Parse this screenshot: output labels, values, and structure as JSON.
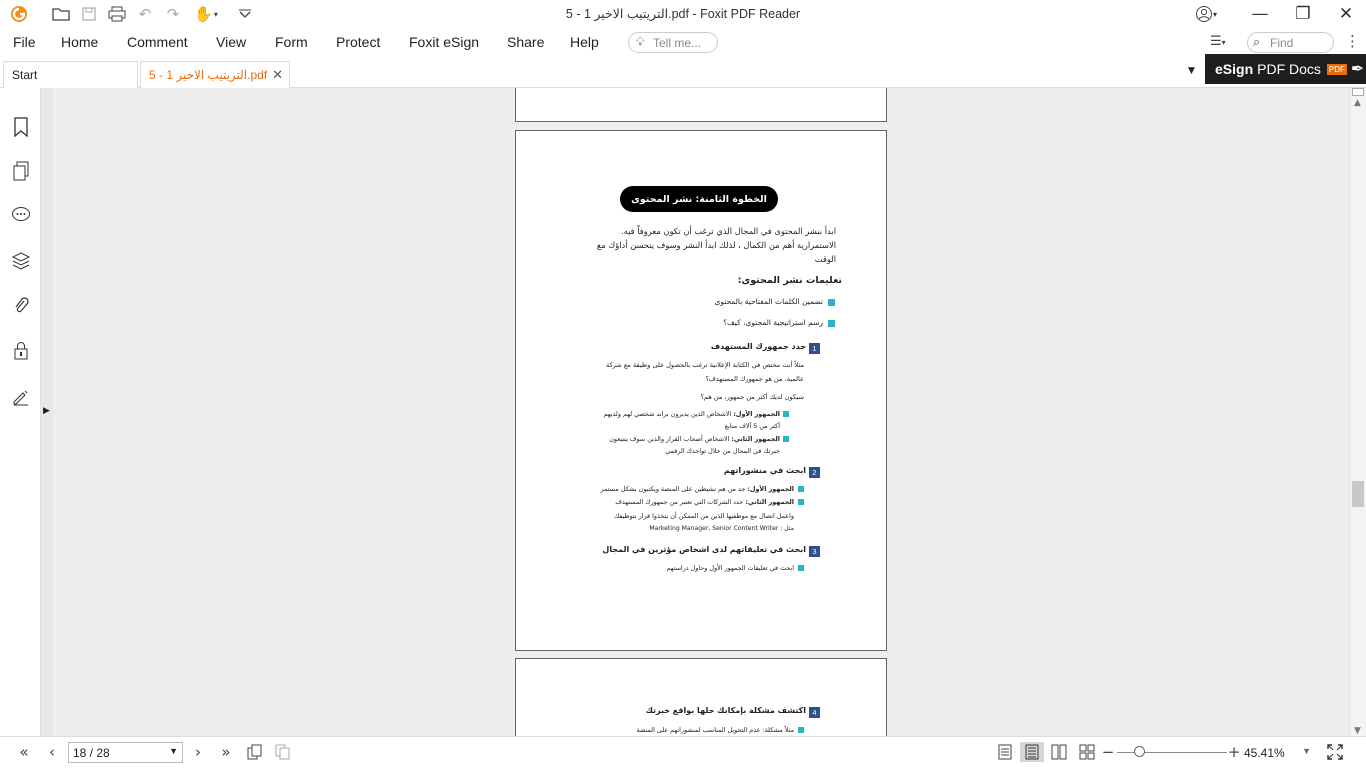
{
  "window": {
    "title": "5 - التريتيب الاخير 1.pdf - Foxit PDF Reader",
    "minimize": "—",
    "restore": "❐",
    "close": "✕"
  },
  "quick_access": {
    "app_logo": "foxit-logo",
    "icons": [
      "open-folder-icon",
      "save-icon",
      "print-icon",
      "undo-icon",
      "redo-icon",
      "hand-tool-icon",
      "customize-dropdown-icon"
    ]
  },
  "menu": {
    "items": [
      "File",
      "Home",
      "Comment",
      "View",
      "Form",
      "Protect",
      "Foxit eSign",
      "Share",
      "Help"
    ],
    "tell_me_placeholder": "Tell me...",
    "find_placeholder": "Find"
  },
  "tabs": [
    {
      "label": "Start",
      "active": false
    },
    {
      "label": "5 - التريتيب الاخير 1.pdf",
      "active": true
    }
  ],
  "esign_banner": {
    "bold": "eSign",
    "rest": "PDF Docs",
    "badge": "PDF"
  },
  "sidebar": {
    "icons": [
      "bookmark-icon",
      "pages-icon",
      "comments-icon",
      "layers-icon",
      "attachments-icon",
      "security-icon",
      "signature-icon"
    ]
  },
  "page_content": {
    "heading_pill": "الخطوة الثامنة: نشر المحتوى",
    "intro_lines": [
      "ابدأ بنشر المحتوى في المجال الذي ترغب أن تكون معروفاً فيه.",
      "الاستمرارية أهم من الكمال ، لذلك ابدأ النشر وسوف يتحسن أداؤك مع",
      "الوقت"
    ],
    "instructions_title": "تعليمات نشر المحتوى:",
    "instructions": [
      "تضمين الكلمات المفتاحية بالمحتوى",
      "رسم استراتيجية المحتوى، كيف؟"
    ],
    "step1": {
      "num": "1",
      "title": "حدد جمهورك المستهدف",
      "lines": [
        "مثلاً أنت مختص في الكتابة الإعلانية ترغب بالحصول على وظيفة مع شركة",
        "عالمية، من هو جمهورك المستهدف؟",
        "سيكون لديك أكثر من جمهور، من هم؟"
      ],
      "bullets": [
        {
          "label": "الجمهور الأول:",
          "text": " الاشخاص الذين يديرون براند شخصي لهم ولديهم",
          "cont": "أكثر من 5 آلاف متابع"
        },
        {
          "label": "الجمهور الثاني:",
          "text": " الاشخاص أصحاب القرار والذين سوف يتتبعون",
          "cont": "خبرتك في المجال من خلال تواجدك الرقمي"
        }
      ]
    },
    "step2": {
      "num": "2",
      "title": "ابحث في منشوراتهم",
      "bullets": [
        {
          "label": "الجمهور الأول:",
          "text": " جد من هم نشيطين على المنصة ويكتبون بشكل مستمر"
        },
        {
          "label": "الجمهور الثاني:",
          "text": " حدد الشركات التي تعتبر من جمهورك المستهدف"
        }
      ],
      "extra_lines": [
        "واعمل اتصال مع موظفيها الذين من الممكن أن يتخذوا قرار بتوظيفك",
        "مثل : Marketing Manager, Senior Content Writer"
      ]
    },
    "step3": {
      "num": "3",
      "title": "ابحث في تعليقاتهم لدى اشخاص مؤثرين في المجال",
      "bullet": "ابحث في تعليقات الجمهور الأول وحاول دراستهم"
    },
    "step4": {
      "num": "4",
      "title": "اكتشف مشكلة بإمكانك حلها بواقع خبرتك",
      "bullet": "مثلاً مشكلة: عدم التحويل المناسب لمنشوراتهم على المنصة"
    }
  },
  "status": {
    "page_indicator": "18 / 28",
    "zoom": "45.41%",
    "nav_icons": [
      "first-page-icon",
      "prev-page-icon",
      "next-page-icon",
      "last-page-icon"
    ],
    "view_icons": [
      "single-page-icon",
      "continuous-icon",
      "facing-icon",
      "continuous-facing-icon"
    ]
  },
  "colors": {
    "accent_orange": "#e86c0c",
    "bullet_teal": "#29b5c9",
    "number_navy": "#2f4f8f"
  }
}
